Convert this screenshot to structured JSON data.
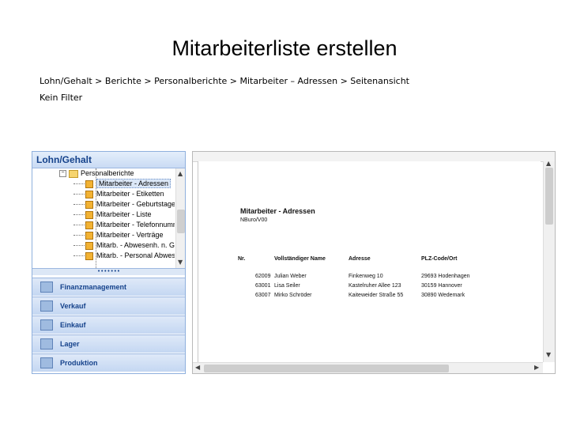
{
  "slide": {
    "title": "Mitarbeiterliste  erstellen",
    "breadcrumb": "Lohn/Gehalt > Berichte > Personalberichte > Mitarbeiter – Adressen > Seitenansicht",
    "filter": "Kein Filter"
  },
  "nav": {
    "header": "Lohn/Gehalt",
    "folder": "Personalberichte",
    "items": [
      "Mitarbeiter - Adressen",
      "Mitarbeiter - Etiketten",
      "Mitarbeiter - Geburtstage",
      "Mitarbeiter - Liste",
      "Mitarbeiter - Telefonnumm",
      "Mitarbeiter - Verträge",
      "Mitarb. - Abwesenh. n. Gru",
      "Mitarb. - Personal Abweser"
    ],
    "selected_index": 0,
    "sections": [
      "Finanzmanagement",
      "Verkauf",
      "Einkauf",
      "Lager",
      "Produktion"
    ]
  },
  "report": {
    "title": "Mitarbeiter - Adressen",
    "subtitle": "NBuro/V00",
    "columns": [
      "Nr.",
      "Vollständiger Name",
      "Adresse",
      "PLZ-Code/Ort"
    ],
    "rows": [
      [
        "62009",
        "Julian Weber",
        "Finkenweg 10",
        "29693 Hodenhagen"
      ],
      [
        "63001",
        "Lisa Seiler",
        "Kastelruher Allee 123",
        "30159 Hannover"
      ],
      [
        "63007",
        "Mirko Schröder",
        "Kaiteweider Straße 55",
        "30890 Wedemark"
      ]
    ]
  }
}
